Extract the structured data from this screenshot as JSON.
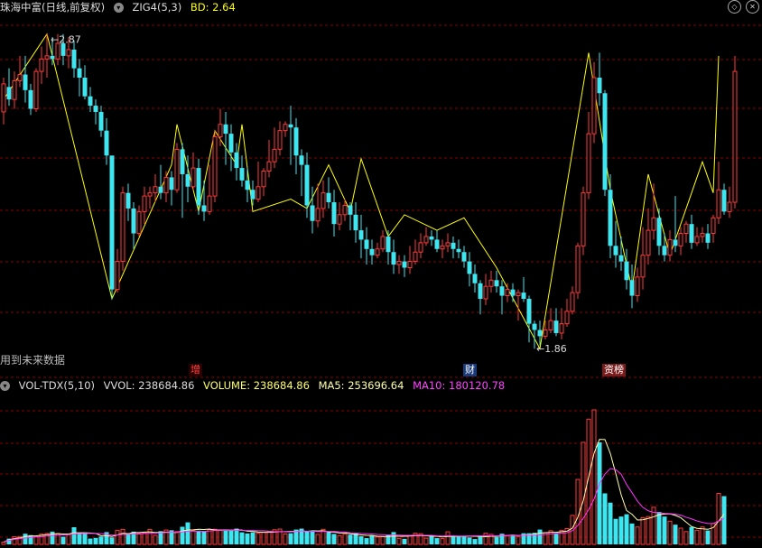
{
  "header": {
    "stock_title": "珠海中富(日线,前复权)",
    "indicator": "ZIG4(5,3)",
    "bd_label": "BD: 2.64"
  },
  "price_panel": {
    "high_label": "2.87",
    "low_label": "1.86",
    "future_note": "用到未来数据",
    "events": [
      {
        "label": "增",
        "color": "#ff4444"
      },
      {
        "label": "财",
        "color": "#ffffff"
      },
      {
        "label": "资榜",
        "color": "#ffffff"
      }
    ]
  },
  "volume_header": {
    "name": "VOL-TDX(5,10)",
    "vvol": "VVOL: 238684.86",
    "volume": "VOLUME: 238684.86",
    "ma5": "MA5: 253696.64",
    "ma10": "MA10: 180120.78"
  },
  "icons": [
    "chevron-down-icon",
    "chevron-down-icon",
    "diamond-icon",
    "close-icon"
  ],
  "colors": {
    "up": "#ff3b3b",
    "down": "#3fe6ef",
    "zig": "#ffff00",
    "ma5": "#ffffaa",
    "ma10": "#ff33ff",
    "grid": "#8b0000"
  },
  "chart_data": [
    {
      "type": "candlestick",
      "title": "珠海中富(日线,前复权)",
      "ylim": [
        1.82,
        2.93
      ],
      "candles": [
        [
          2.62,
          2.71,
          2.73,
          2.58
        ],
        [
          2.7,
          2.66,
          2.76,
          2.64
        ],
        [
          2.66,
          2.72,
          2.75,
          2.63
        ],
        [
          2.72,
          2.74,
          2.8,
          2.7
        ],
        [
          2.74,
          2.69,
          2.8,
          2.65
        ],
        [
          2.69,
          2.63,
          2.71,
          2.61
        ],
        [
          2.63,
          2.75,
          2.76,
          2.62
        ],
        [
          2.75,
          2.79,
          2.83,
          2.71
        ],
        [
          2.79,
          2.8,
          2.87,
          2.73
        ],
        [
          2.8,
          2.79,
          2.86,
          2.77
        ],
        [
          2.79,
          2.84,
          2.87,
          2.77
        ],
        [
          2.84,
          2.8,
          2.87,
          2.77
        ],
        [
          2.8,
          2.82,
          2.86,
          2.76
        ],
        [
          2.82,
          2.76,
          2.85,
          2.73
        ],
        [
          2.76,
          2.73,
          2.79,
          2.67
        ],
        [
          2.73,
          2.67,
          2.77,
          2.66
        ],
        [
          2.67,
          2.64,
          2.7,
          2.62
        ],
        [
          2.64,
          2.62,
          2.66,
          2.58
        ],
        [
          2.62,
          2.56,
          2.64,
          2.54
        ],
        [
          2.56,
          2.48,
          2.6,
          2.45
        ],
        [
          2.48,
          2.05,
          2.22,
          2.02
        ],
        [
          2.05,
          2.14,
          2.18,
          2.04
        ],
        [
          2.14,
          2.36,
          2.38,
          2.11
        ],
        [
          2.36,
          2.31,
          2.39,
          2.27
        ],
        [
          2.31,
          2.23,
          2.33,
          2.18
        ],
        [
          2.23,
          2.3,
          2.32,
          2.22
        ],
        [
          2.3,
          2.35,
          2.38,
          2.26
        ],
        [
          2.35,
          2.36,
          2.38,
          2.31
        ],
        [
          2.36,
          2.38,
          2.42,
          2.33
        ],
        [
          2.38,
          2.36,
          2.45,
          2.34
        ],
        [
          2.36,
          2.41,
          2.43,
          2.33
        ],
        [
          2.41,
          2.37,
          2.43,
          2.32
        ],
        [
          2.37,
          2.5,
          2.52,
          2.36
        ],
        [
          2.5,
          2.42,
          2.52,
          2.28
        ],
        [
          2.42,
          2.38,
          2.48,
          2.33
        ],
        [
          2.38,
          2.44,
          2.49,
          2.37
        ],
        [
          2.44,
          2.32,
          2.47,
          2.29
        ],
        [
          2.32,
          2.3,
          2.4,
          2.27
        ],
        [
          2.3,
          2.35,
          2.45,
          2.29
        ],
        [
          2.35,
          2.54,
          2.56,
          2.33
        ],
        [
          2.54,
          2.58,
          2.63,
          2.51
        ],
        [
          2.58,
          2.55,
          2.62,
          2.45
        ],
        [
          2.55,
          2.49,
          2.58,
          2.43
        ],
        [
          2.49,
          2.44,
          2.52,
          2.4
        ],
        [
          2.44,
          2.4,
          2.48,
          2.38
        ],
        [
          2.4,
          2.37,
          2.44,
          2.33
        ],
        [
          2.37,
          2.34,
          2.4,
          2.32
        ],
        [
          2.34,
          2.38,
          2.46,
          2.33
        ],
        [
          2.38,
          2.43,
          2.44,
          2.35
        ],
        [
          2.43,
          2.46,
          2.53,
          2.41
        ],
        [
          2.46,
          2.5,
          2.57,
          2.44
        ],
        [
          2.5,
          2.56,
          2.59,
          2.48
        ],
        [
          2.56,
          2.58,
          2.59,
          2.54
        ],
        [
          2.58,
          2.57,
          2.64,
          2.45
        ],
        [
          2.57,
          2.48,
          2.6,
          2.42
        ],
        [
          2.48,
          2.45,
          2.5,
          2.35
        ],
        [
          2.45,
          2.32,
          2.49,
          2.28
        ],
        [
          2.32,
          2.27,
          2.38,
          2.23
        ],
        [
          2.27,
          2.31,
          2.39,
          2.25
        ],
        [
          2.31,
          2.36,
          2.4,
          2.28
        ],
        [
          2.36,
          2.33,
          2.41,
          2.31
        ],
        [
          2.33,
          2.26,
          2.37,
          2.22
        ],
        [
          2.26,
          2.29,
          2.33,
          2.24
        ],
        [
          2.29,
          2.32,
          2.34,
          2.27
        ],
        [
          2.32,
          2.29,
          2.33,
          2.24
        ],
        [
          2.29,
          2.24,
          2.33,
          2.2
        ],
        [
          2.24,
          2.21,
          2.29,
          2.15
        ],
        [
          2.21,
          2.18,
          2.25,
          2.13
        ],
        [
          2.18,
          2.16,
          2.21,
          2.13
        ],
        [
          2.16,
          2.18,
          2.2,
          2.15
        ],
        [
          2.18,
          2.22,
          2.24,
          2.17
        ],
        [
          2.22,
          2.17,
          2.24,
          2.13
        ],
        [
          2.17,
          2.13,
          2.21,
          2.1
        ],
        [
          2.13,
          2.14,
          2.16,
          2.1
        ],
        [
          2.14,
          2.12,
          2.16,
          2.09
        ],
        [
          2.12,
          2.14,
          2.19,
          2.1
        ],
        [
          2.14,
          2.17,
          2.21,
          2.13
        ],
        [
          2.17,
          2.2,
          2.23,
          2.15
        ],
        [
          2.2,
          2.22,
          2.25,
          2.19
        ],
        [
          2.22,
          2.21,
          2.24,
          2.19
        ],
        [
          2.21,
          2.18,
          2.24,
          2.17
        ],
        [
          2.18,
          2.19,
          2.21,
          2.15
        ],
        [
          2.19,
          2.2,
          2.23,
          2.17
        ],
        [
          2.2,
          2.18,
          2.22,
          2.15
        ],
        [
          2.18,
          2.17,
          2.21,
          2.15
        ],
        [
          2.17,
          2.14,
          2.19,
          2.12
        ],
        [
          2.14,
          2.1,
          2.17,
          2.06
        ],
        [
          2.1,
          2.07,
          2.13,
          2.04
        ],
        [
          2.07,
          2.02,
          2.08,
          1.97
        ],
        [
          2.02,
          2.06,
          2.1,
          2.0
        ],
        [
          2.06,
          2.08,
          2.11,
          2.04
        ],
        [
          2.08,
          2.06,
          2.11,
          2.04
        ],
        [
          2.06,
          2.03,
          2.08,
          1.97
        ],
        [
          2.03,
          2.05,
          2.07,
          2.01
        ],
        [
          2.05,
          2.03,
          2.07,
          2.01
        ],
        [
          2.03,
          2.04,
          2.05,
          1.95
        ],
        [
          2.04,
          2.02,
          2.09,
          2.01
        ],
        [
          2.02,
          1.94,
          2.03,
          1.88
        ],
        [
          1.94,
          1.92,
          1.95,
          1.86
        ],
        [
          1.92,
          1.9,
          1.95,
          1.87
        ],
        [
          1.9,
          1.92,
          1.95,
          1.89
        ],
        [
          1.92,
          1.95,
          1.99,
          1.91
        ],
        [
          1.95,
          1.91,
          1.99,
          1.9
        ],
        [
          1.91,
          1.94,
          1.99,
          1.89
        ],
        [
          1.94,
          1.98,
          2.02,
          1.93
        ],
        [
          1.98,
          2.04,
          2.06,
          1.97
        ],
        [
          2.04,
          2.19,
          2.2,
          2.02
        ],
        [
          2.19,
          2.36,
          2.38,
          2.16
        ],
        [
          2.36,
          2.55,
          2.62,
          2.34
        ],
        [
          2.55,
          2.73,
          2.78,
          2.52
        ],
        [
          2.73,
          2.68,
          2.81,
          2.64
        ],
        [
          2.68,
          2.37,
          2.69,
          2.35
        ],
        [
          2.37,
          2.19,
          2.42,
          2.15
        ],
        [
          2.19,
          2.16,
          2.27,
          2.12
        ],
        [
          2.16,
          2.14,
          2.22,
          2.11
        ],
        [
          2.14,
          2.08,
          2.18,
          2.05
        ],
        [
          2.08,
          2.03,
          2.13,
          1.99
        ],
        [
          2.03,
          2.09,
          2.12,
          2.01
        ],
        [
          2.09,
          2.16,
          2.25,
          2.05
        ],
        [
          2.16,
          2.24,
          2.31,
          2.13
        ],
        [
          2.24,
          2.28,
          2.39,
          2.21
        ],
        [
          2.28,
          2.19,
          2.31,
          2.16
        ],
        [
          2.19,
          2.16,
          2.23,
          2.14
        ],
        [
          2.16,
          2.21,
          2.24,
          2.14
        ],
        [
          2.21,
          2.19,
          2.35,
          2.17
        ],
        [
          2.19,
          2.23,
          2.25,
          2.16
        ],
        [
          2.23,
          2.26,
          2.27,
          2.2
        ],
        [
          2.26,
          2.2,
          2.29,
          2.18
        ],
        [
          2.2,
          2.22,
          2.25,
          2.19
        ],
        [
          2.22,
          2.23,
          2.25,
          2.2
        ],
        [
          2.23,
          2.2,
          2.26,
          2.18
        ],
        [
          2.23,
          2.28,
          2.29,
          2.2
        ],
        [
          2.28,
          2.37,
          2.46,
          2.26
        ],
        [
          2.37,
          2.3,
          2.39,
          2.29
        ],
        [
          2.3,
          2.33,
          2.38,
          2.28
        ],
        [
          2.33,
          2.75,
          2.8,
          2.31
        ]
      ],
      "zig": [
        [
          0,
          2.66
        ],
        [
          8,
          2.87
        ],
        [
          20,
          2.02
        ],
        [
          31,
          2.45
        ],
        [
          32,
          2.58
        ],
        [
          36,
          2.3
        ],
        [
          39,
          2.56
        ],
        [
          43,
          2.45
        ],
        [
          44,
          2.58
        ],
        [
          46,
          2.3
        ],
        [
          53,
          2.34
        ],
        [
          56,
          2.31
        ],
        [
          60,
          2.45
        ],
        [
          64,
          2.3
        ],
        [
          66,
          2.47
        ],
        [
          71,
          2.22
        ],
        [
          74,
          2.29
        ],
        [
          80,
          2.24
        ],
        [
          85,
          2.28
        ],
        [
          91,
          2.12
        ],
        [
          99,
          1.86
        ],
        [
          108,
          2.81
        ],
        [
          112,
          2.37
        ],
        [
          116,
          2.05
        ],
        [
          119,
          2.42
        ],
        [
          123,
          2.16
        ],
        [
          129,
          2.46
        ],
        [
          131,
          2.36
        ],
        [
          132,
          2.8
        ]
      ]
    },
    {
      "type": "bar",
      "title": "VOL-TDX(5,10)",
      "ylim": [
        0,
        650000
      ],
      "values": [
        10,
        25,
        33,
        34,
        46,
        40,
        33,
        44,
        47,
        55,
        47,
        33,
        43,
        74,
        50,
        51,
        25,
        28,
        34,
        53,
        30,
        60,
        65,
        48,
        55,
        47,
        50,
        65,
        39,
        57,
        62,
        61,
        55,
        76,
        95,
        60,
        59,
        58,
        64,
        65,
        62,
        64,
        62,
        68,
        52,
        47,
        52,
        48,
        52,
        57,
        63,
        66,
        45,
        48,
        64,
        68,
        55,
        59,
        43,
        65,
        53,
        45,
        38,
        44,
        42,
        47,
        35,
        27,
        40,
        32,
        33,
        40,
        53,
        26,
        24,
        37,
        48,
        46,
        27,
        35,
        27,
        25,
        54,
        33,
        34,
        33,
        30,
        23,
        33,
        48,
        43,
        32,
        46,
        36,
        40,
        34,
        48,
        48,
        50,
        64,
        51,
        59,
        46,
        60,
        68,
        125,
        280,
        440,
        540,
        580,
        440,
        220,
        180,
        110,
        120,
        130,
        90,
        75,
        115,
        120,
        160,
        140,
        120,
        100,
        85,
        70,
        55,
        75,
        60,
        75,
        60,
        90,
        220,
        208
      ],
      "ma5": [
        10,
        20,
        25,
        28,
        34,
        36,
        37,
        39,
        42,
        44,
        46,
        45,
        45,
        50,
        50,
        50,
        49,
        47,
        37,
        38,
        34,
        41,
        48,
        46,
        51,
        51,
        53,
        54,
        51,
        52,
        53,
        52,
        51,
        58,
        62,
        63,
        65,
        64,
        66,
        62,
        62,
        62,
        62,
        62,
        62,
        57,
        56,
        53,
        52,
        52,
        53,
        55,
        55,
        56,
        57,
        58,
        56,
        59,
        58,
        59,
        54,
        53,
        49,
        49,
        46,
        43,
        41,
        39,
        38,
        35,
        34,
        34,
        36,
        35,
        35,
        36,
        38,
        38,
        37,
        36,
        35,
        32,
        34,
        35,
        35,
        35,
        36,
        35,
        35,
        33,
        35,
        35,
        37,
        39,
        40,
        38,
        41,
        42,
        44,
        49,
        50,
        52,
        52,
        55,
        57,
        70,
        117,
        188,
        291,
        393,
        453,
        452,
        392,
        306,
        214,
        146,
        130,
        105,
        106,
        112,
        119,
        128,
        131,
        132,
        125,
        115,
        96,
        77,
        69,
        67,
        65,
        72,
        101,
        130
      ],
      "ma10": [
        10,
        18,
        22,
        25,
        27,
        30,
        32,
        33,
        36,
        38,
        40,
        41,
        42,
        45,
        46,
        47,
        47,
        47,
        46,
        43,
        40,
        41,
        43,
        43,
        45,
        45,
        47,
        48,
        48,
        50,
        51,
        52,
        52,
        54,
        57,
        57,
        57,
        56,
        58,
        60,
        60,
        61,
        61,
        61,
        60,
        60,
        60,
        59,
        59,
        57,
        55,
        55,
        54,
        54,
        56,
        58,
        57,
        57,
        55,
        56,
        56,
        56,
        54,
        53,
        50,
        49,
        47,
        46,
        45,
        43,
        42,
        41,
        41,
        40,
        39,
        39,
        40,
        40,
        39,
        39,
        37,
        36,
        37,
        37,
        36,
        36,
        36,
        37,
        37,
        37,
        37,
        37,
        38,
        39,
        38,
        38,
        40,
        40,
        40,
        41,
        43,
        45,
        47,
        49,
        50,
        59,
        82,
        112,
        150,
        195,
        262,
        303,
        327,
        322,
        303,
        258,
        223,
        187,
        160,
        145,
        138,
        136,
        134,
        133,
        130,
        126,
        117,
        110,
        101,
        95,
        90,
        90,
        101,
        111
      ]
    }
  ]
}
